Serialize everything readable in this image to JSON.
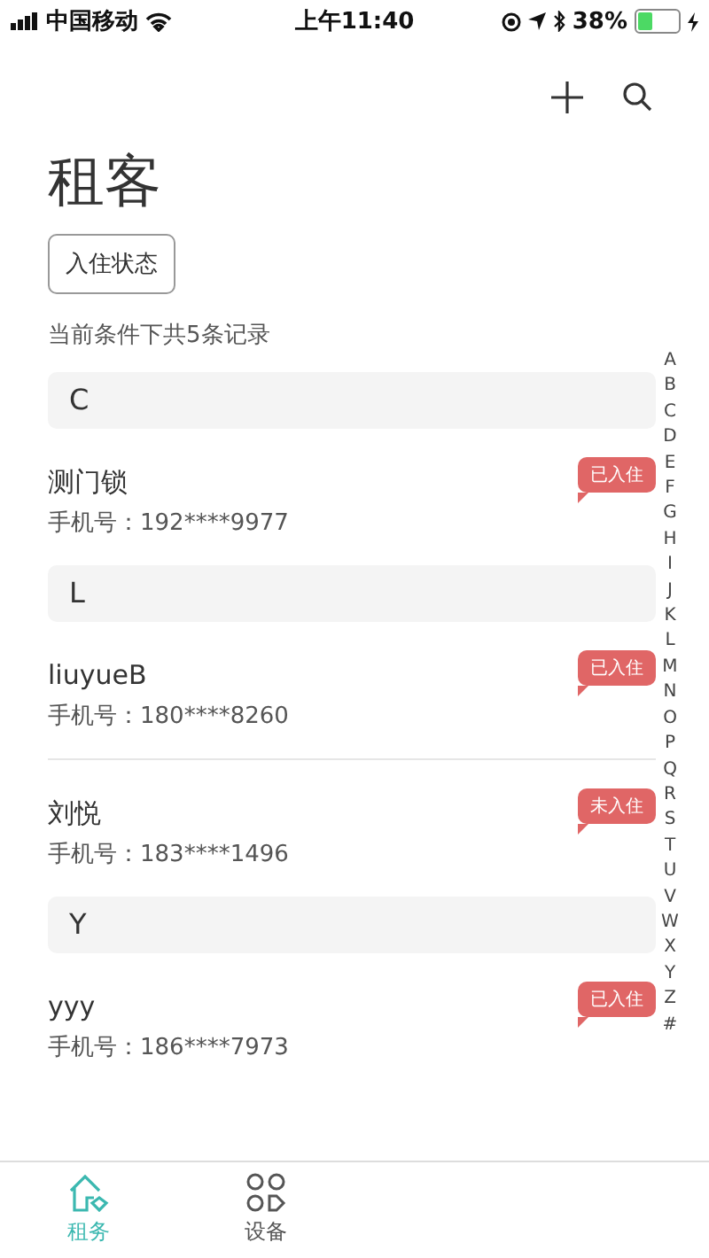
{
  "status_bar": {
    "carrier": "中国移动",
    "time": "上午11:40",
    "battery": "38%"
  },
  "header": {
    "title": "租客",
    "filter_button": "入住状态",
    "summary": "当前条件下共5条记录"
  },
  "sections": [
    {
      "letter": "C",
      "tenants": [
        {
          "name": "测门锁",
          "phone": "手机号：192****9977",
          "status": "已入住"
        }
      ]
    },
    {
      "letter": "L",
      "tenants": [
        {
          "name": "liuyueB",
          "phone": "手机号：180****8260",
          "status": "已入住"
        },
        {
          "name": "刘悦",
          "phone": "手机号：183****1496",
          "status": "未入住"
        }
      ]
    },
    {
      "letter": "Y",
      "tenants": [
        {
          "name": "yyy",
          "phone": "手机号：186****7973",
          "status": "已入住"
        }
      ]
    }
  ],
  "index": [
    "A",
    "B",
    "C",
    "D",
    "E",
    "F",
    "G",
    "H",
    "I",
    "J",
    "K",
    "L",
    "M",
    "N",
    "O",
    "P",
    "Q",
    "R",
    "S",
    "T",
    "U",
    "V",
    "W",
    "X",
    "Y",
    "Z",
    "#"
  ],
  "tabs": [
    {
      "label": "租务",
      "kind": "house",
      "selected": true
    },
    {
      "label": "设备",
      "kind": "grid",
      "selected": false
    }
  ]
}
